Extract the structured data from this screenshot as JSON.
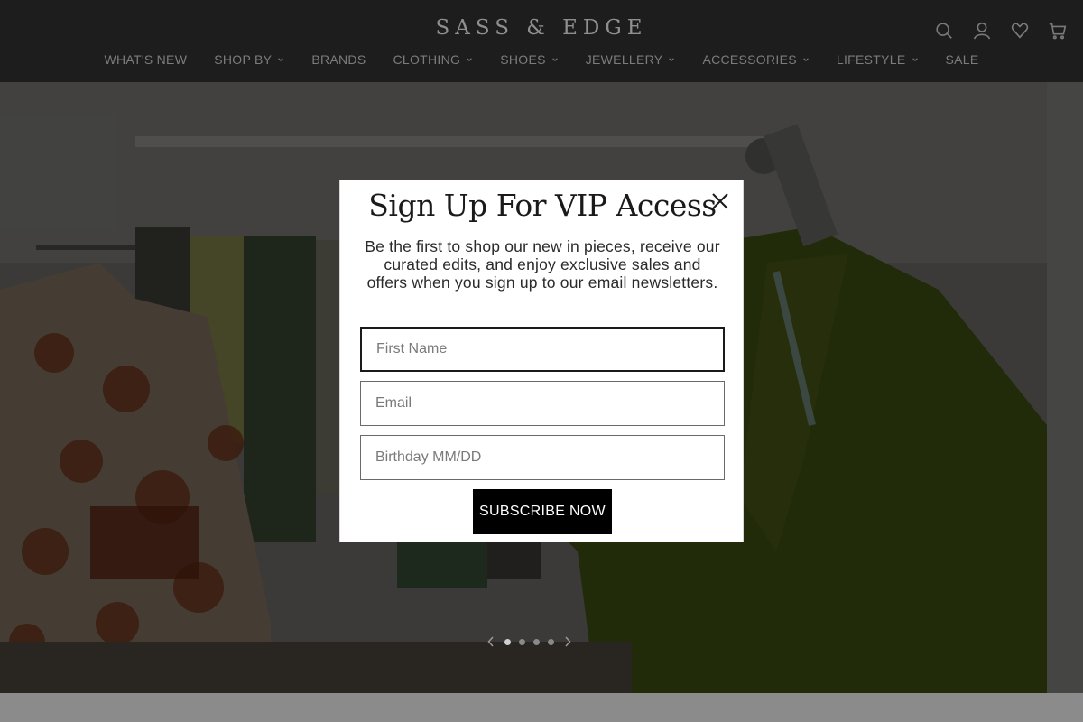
{
  "brand": {
    "logo": "SASS & EDGE"
  },
  "header": {
    "icons": [
      "search-icon",
      "account-icon",
      "wishlist-icon",
      "cart-icon"
    ]
  },
  "nav": [
    {
      "label": "WHAT'S NEW",
      "dropdown": false
    },
    {
      "label": "SHOP BY",
      "dropdown": true
    },
    {
      "label": "BRANDS",
      "dropdown": false
    },
    {
      "label": "CLOTHING",
      "dropdown": true
    },
    {
      "label": "SHOES",
      "dropdown": true
    },
    {
      "label": "JEWELLERY",
      "dropdown": true
    },
    {
      "label": "ACCESSORIES",
      "dropdown": true
    },
    {
      "label": "LIFESTYLE",
      "dropdown": true
    },
    {
      "label": "SALE",
      "dropdown": false
    }
  ],
  "modal": {
    "title": "Sign Up For VIP Access",
    "description": "Be the first to shop our new in pieces, receive our curated edits, and enjoy exclusive sales and offers when you sign up to our email newsletters.",
    "fields": {
      "first_name": {
        "placeholder": "First Name",
        "value": ""
      },
      "email": {
        "placeholder": "Email",
        "value": ""
      },
      "birthday": {
        "placeholder": "Birthday MM/DD",
        "value": ""
      }
    },
    "submit_label": "SUBSCRIBE NOW"
  },
  "carousel": {
    "slides": 4,
    "active": 1
  },
  "colors": {
    "header_bg": "#1d1d1d",
    "nav_text": "#7c7c7c",
    "modal_bg": "#ffffff",
    "button_bg": "#000000",
    "overlay": "rgba(0,0,0,0.35)"
  }
}
